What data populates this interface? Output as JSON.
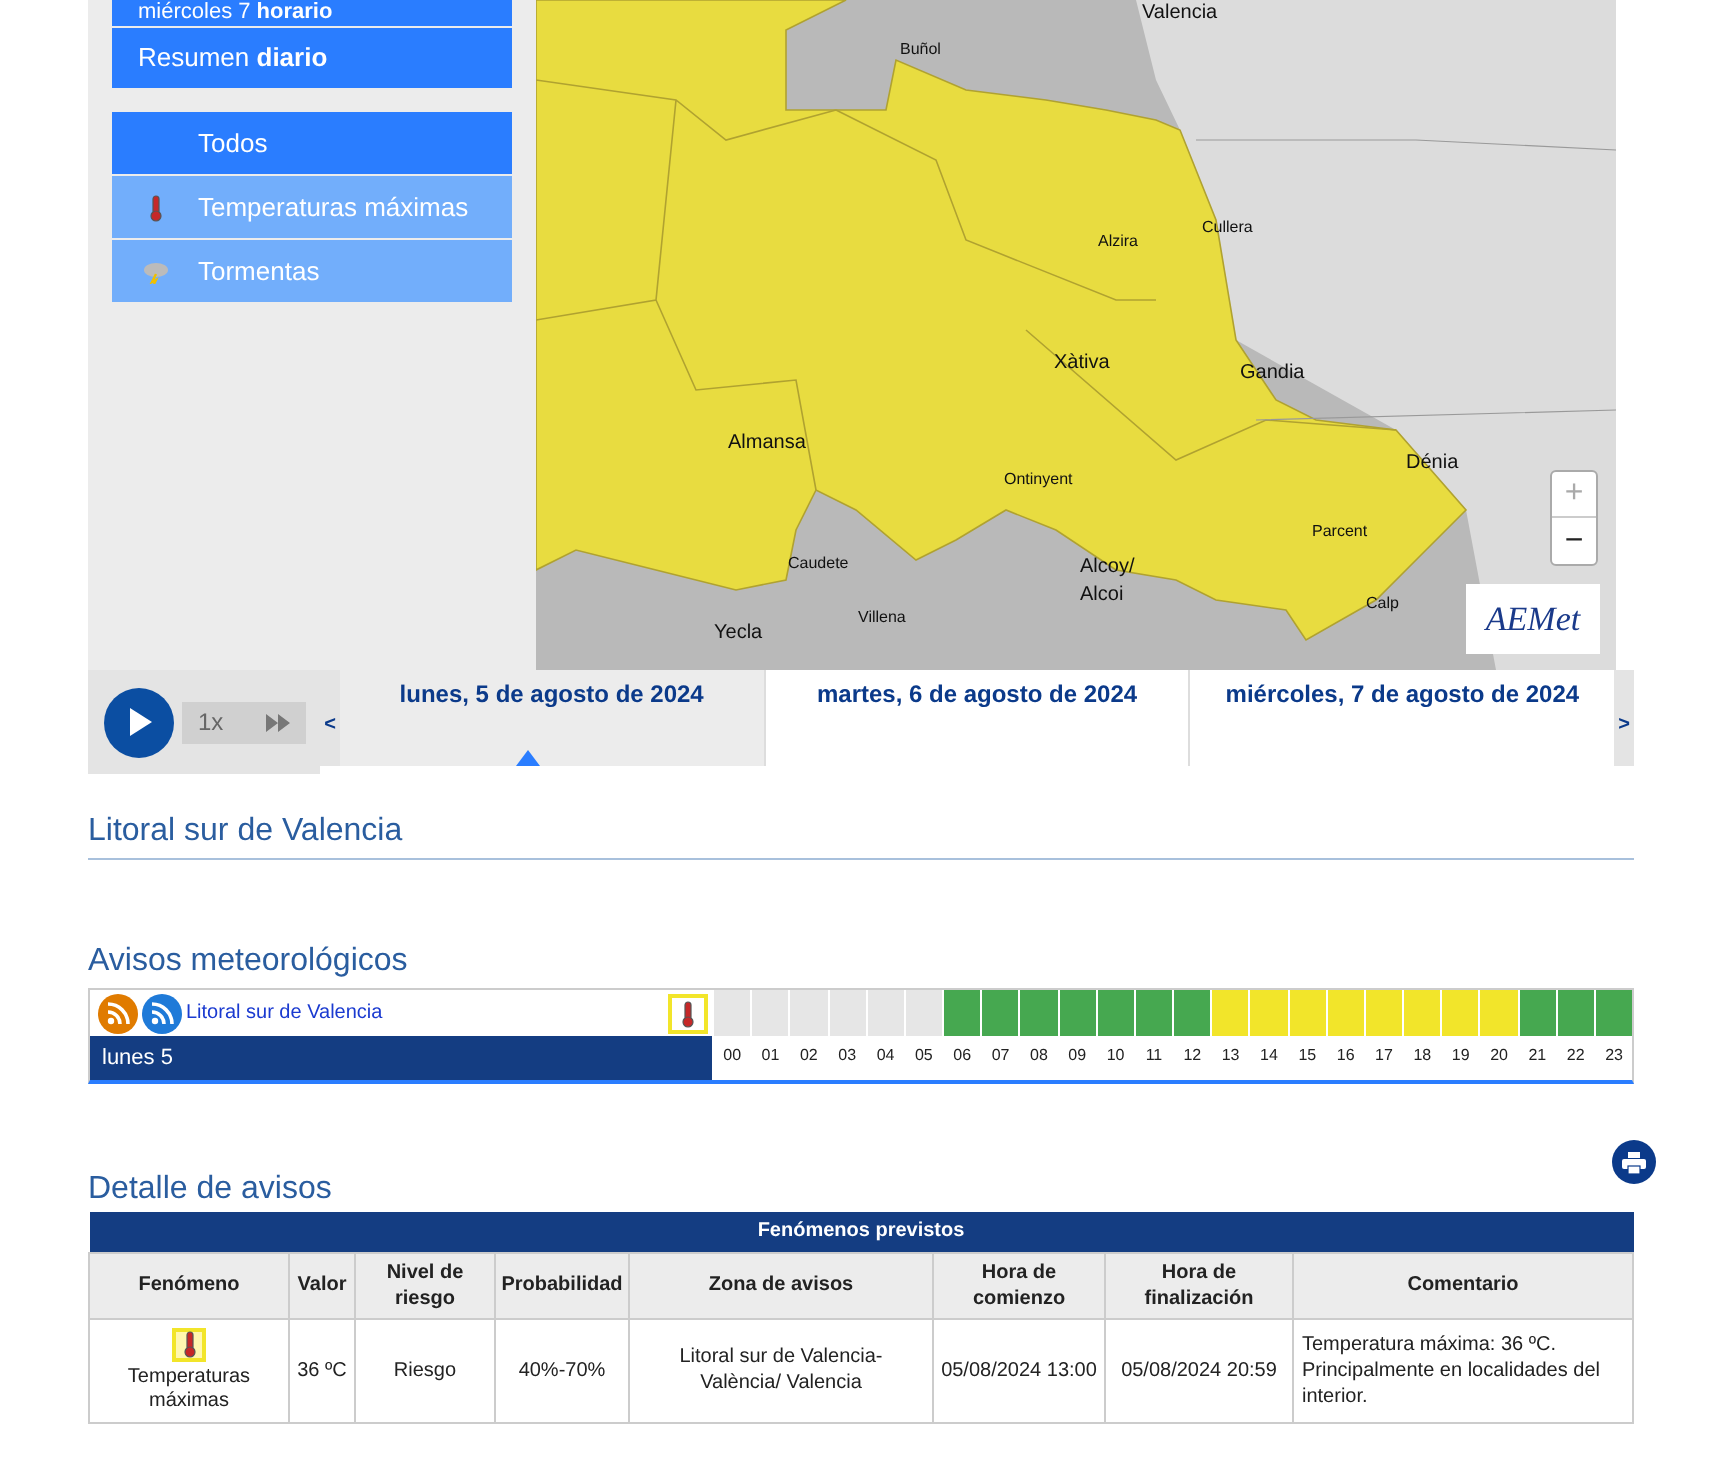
{
  "sidebar": {
    "view_items": [
      {
        "label": "miércoles 7 **horario**",
        "selected": false
      },
      {
        "label": "Resumen **diario**",
        "selected": false
      }
    ],
    "filters": [
      {
        "label": "Todos",
        "selected": true,
        "kind": "none"
      },
      {
        "label": "Temperaturas máximas",
        "selected": false,
        "kind": "heat"
      },
      {
        "label": "Tormentas",
        "selected": false,
        "kind": "storm"
      }
    ]
  },
  "map": {
    "cities": [
      "Valencia",
      "Buñol",
      "Alzira",
      "Cullera",
      "Xàtiva",
      "Gandia",
      "Almansa",
      "Ontinyent",
      "Dénia",
      "Parcent",
      "Caudete",
      "Alcoy/ Alcoi",
      "Calp",
      "Villena",
      "Yecla"
    ],
    "zoom_in": "+",
    "zoom_out": "−",
    "logo": "AEMet"
  },
  "timeline": {
    "speed": "1x",
    "prev": "<",
    "next": ">",
    "days": [
      {
        "label": "lunes, 5 de agosto de 2024",
        "selected": true
      },
      {
        "label": "martes, 6 de agosto de 2024",
        "selected": false
      },
      {
        "label": "miércoles, 7 de agosto de 2024",
        "selected": false
      }
    ]
  },
  "zone_title": "Litoral sur de Valencia",
  "warnings": {
    "title": "Avisos meteorológicos",
    "zone_link": "Litoral sur de Valencia",
    "day": "lunes 5",
    "hours": [
      {
        "label": "00",
        "color": "#e6e6e6"
      },
      {
        "label": "01",
        "color": "#e6e6e6"
      },
      {
        "label": "02",
        "color": "#e6e6e6"
      },
      {
        "label": "03",
        "color": "#e6e6e6"
      },
      {
        "label": "04",
        "color": "#e6e6e6"
      },
      {
        "label": "05",
        "color": "#e6e6e6"
      },
      {
        "label": "06",
        "color": "#46a850"
      },
      {
        "label": "07",
        "color": "#46a850"
      },
      {
        "label": "08",
        "color": "#46a850"
      },
      {
        "label": "09",
        "color": "#46a850"
      },
      {
        "label": "10",
        "color": "#46a850"
      },
      {
        "label": "11",
        "color": "#46a850"
      },
      {
        "label": "12",
        "color": "#46a850"
      },
      {
        "label": "13",
        "color": "#f2e52a"
      },
      {
        "label": "14",
        "color": "#f2e52a"
      },
      {
        "label": "15",
        "color": "#f2e52a"
      },
      {
        "label": "16",
        "color": "#f2e52a"
      },
      {
        "label": "17",
        "color": "#f2e52a"
      },
      {
        "label": "18",
        "color": "#f2e52a"
      },
      {
        "label": "19",
        "color": "#f2e52a"
      },
      {
        "label": "20",
        "color": "#f2e52a"
      },
      {
        "label": "21",
        "color": "#46a850"
      },
      {
        "label": "22",
        "color": "#46a850"
      },
      {
        "label": "23",
        "color": "#46a850"
      }
    ]
  },
  "detail": {
    "title": "Detalle de avisos",
    "table_title": "Fenómenos previstos",
    "columns": [
      "Fenómeno",
      "Valor",
      "Nivel de riesgo",
      "Probabilidad",
      "Zona de avisos",
      "Hora de comienzo",
      "Hora de finalización",
      "Comentario"
    ],
    "rows": [
      {
        "phenomenon": "Temperaturas máximas",
        "value": "36 ºC",
        "risk": "Riesgo",
        "probability": "40%-70%",
        "zone": "Litoral sur de Valencia-València/ Valencia",
        "start": "05/08/2024 13:00",
        "end": "05/08/2024 20:59",
        "comment": "Temperatura máxima: 36 ºC. Principalmente en localidades del interior."
      }
    ]
  }
}
